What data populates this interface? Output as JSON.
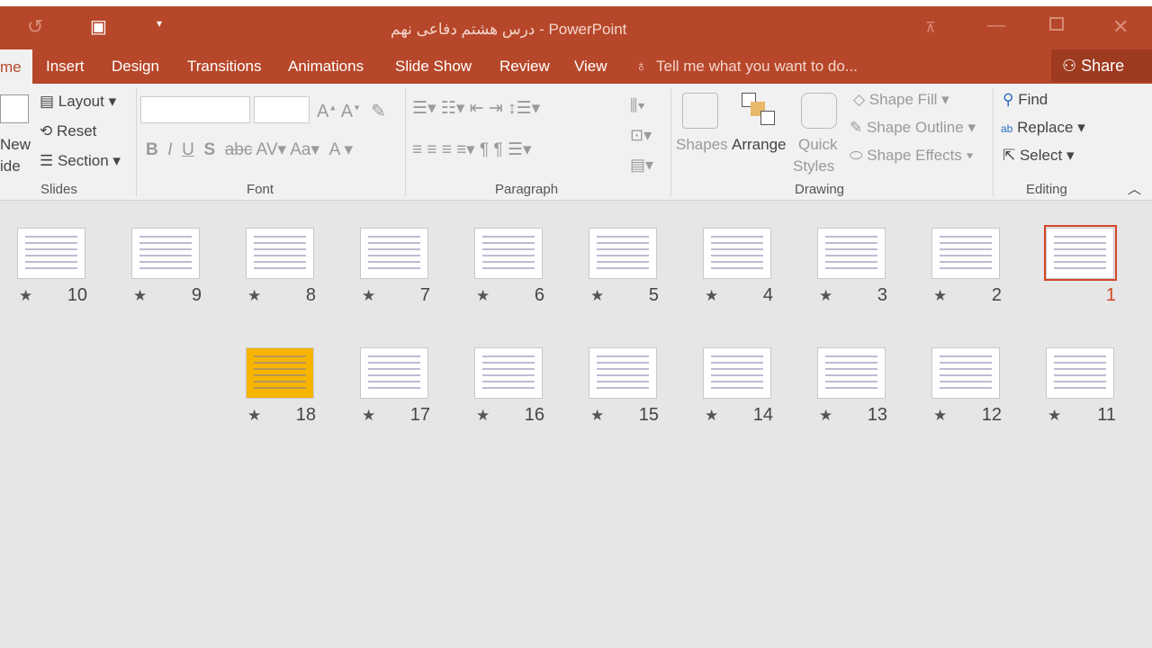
{
  "window": {
    "title": "درس هشتم دفاعی نهم - PowerPoint"
  },
  "tabs": [
    {
      "label": "me"
    },
    {
      "label": "Insert"
    },
    {
      "label": "Design"
    },
    {
      "label": "Transitions"
    },
    {
      "label": "Animations"
    },
    {
      "label": "Slide Show"
    },
    {
      "label": "Review"
    },
    {
      "label": "View"
    }
  ],
  "tell_me": "Tell me what you want to do...",
  "share": "Share",
  "slides_group": {
    "new_slide_1": "New",
    "new_slide_2": "ide",
    "layout": "Layout",
    "reset": "Reset",
    "section": "Section",
    "label": "Slides"
  },
  "font_group": {
    "label": "Font",
    "font_value": "",
    "size_value": ""
  },
  "paragraph_group": {
    "label": "Paragraph"
  },
  "drawing_group": {
    "shapes": "Shapes",
    "arrange": "Arrange",
    "quick": "Quick",
    "styles": "Styles",
    "shape_fill": "Shape Fill",
    "shape_outline": "Shape Outline",
    "shape_effects": "Shape Effects",
    "label": "Drawing"
  },
  "editing_group": {
    "find": "Find",
    "replace": "Replace",
    "select": "Select",
    "label": "Editing"
  },
  "slides": [
    {
      "n": "1",
      "selected": true,
      "star": false
    },
    {
      "n": "2",
      "star": true
    },
    {
      "n": "3",
      "star": true
    },
    {
      "n": "4",
      "star": true
    },
    {
      "n": "5",
      "star": true
    },
    {
      "n": "6",
      "star": true
    },
    {
      "n": "7",
      "star": true
    },
    {
      "n": "8",
      "star": true
    },
    {
      "n": "9",
      "star": true
    },
    {
      "n": "10",
      "star": true
    },
    {
      "n": "11",
      "star": true
    },
    {
      "n": "12",
      "star": true
    },
    {
      "n": "13",
      "star": true
    },
    {
      "n": "14",
      "star": true
    },
    {
      "n": "15",
      "star": true
    },
    {
      "n": "16",
      "star": true
    },
    {
      "n": "17",
      "star": true
    },
    {
      "n": "18",
      "star": true
    }
  ],
  "colors": {
    "accent": "#b7472a",
    "selection": "#d24726"
  }
}
